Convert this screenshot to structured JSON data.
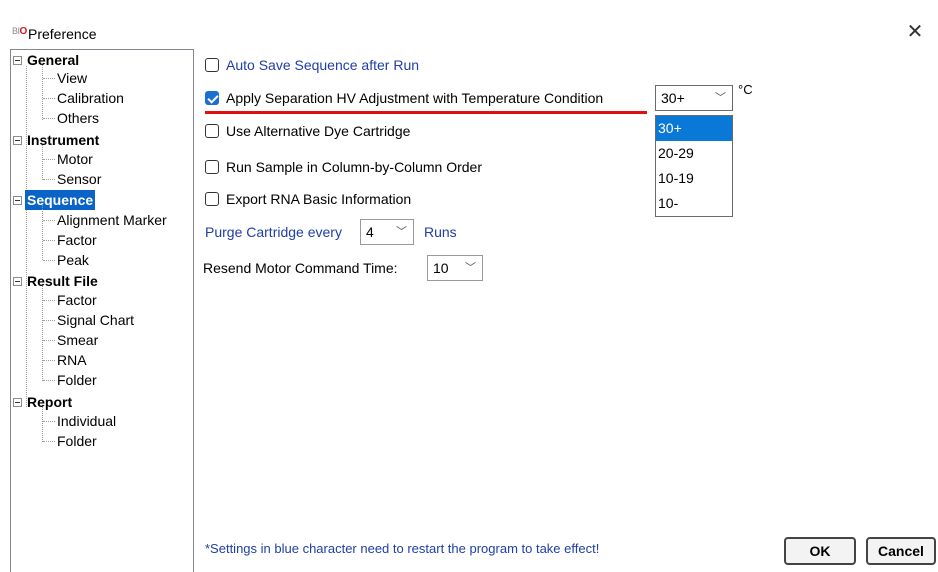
{
  "window": {
    "icon_text": "BIO",
    "title": "Preference",
    "close_glyph": "✕"
  },
  "tree": {
    "groups": [
      {
        "label": "General",
        "children": [
          "View",
          "Calibration",
          "Others"
        ]
      },
      {
        "label": "Instrument",
        "children": [
          "Motor",
          "Sensor"
        ]
      },
      {
        "label": "Sequence",
        "children": [
          "Alignment Marker",
          "Factor",
          "Peak"
        ],
        "selected": true
      },
      {
        "label": "Result File",
        "children": [
          "Factor",
          "Signal Chart",
          "Smear",
          "RNA",
          "Folder"
        ]
      },
      {
        "label": "Report",
        "children": [
          "Individual",
          "Folder"
        ]
      }
    ]
  },
  "settings": {
    "auto_save": {
      "label": "Auto Save Sequence after Run",
      "checked": false
    },
    "apply_hv": {
      "label": "Apply Separation HV Adjustment with Temperature Condition",
      "checked": true
    },
    "temperature": {
      "selected": "30+",
      "unit": "°C",
      "options": [
        "30+",
        "20-29",
        "10-19",
        "10-"
      ]
    },
    "alt_dye": {
      "label": "Use Alternative Dye Cartridge",
      "checked": false
    },
    "column_order": {
      "label": "Run Sample in Column-by-Column Order",
      "checked": false
    },
    "export_rna": {
      "label": "Export RNA Basic Information",
      "checked": false
    },
    "purge": {
      "prefix": "Purge Cartridge every",
      "value": "4",
      "suffix": "Runs"
    },
    "resend": {
      "label": "Resend Motor Command Time:",
      "value": "10"
    }
  },
  "footer": {
    "note": "*Settings in blue character need to restart the program to take effect!",
    "ok_label": "OK",
    "cancel_label": "Cancel"
  },
  "colors": {
    "blue_text": "#1f3ea8",
    "selected_bg": "#0a78d7",
    "highlight_underline": "#e01010"
  }
}
